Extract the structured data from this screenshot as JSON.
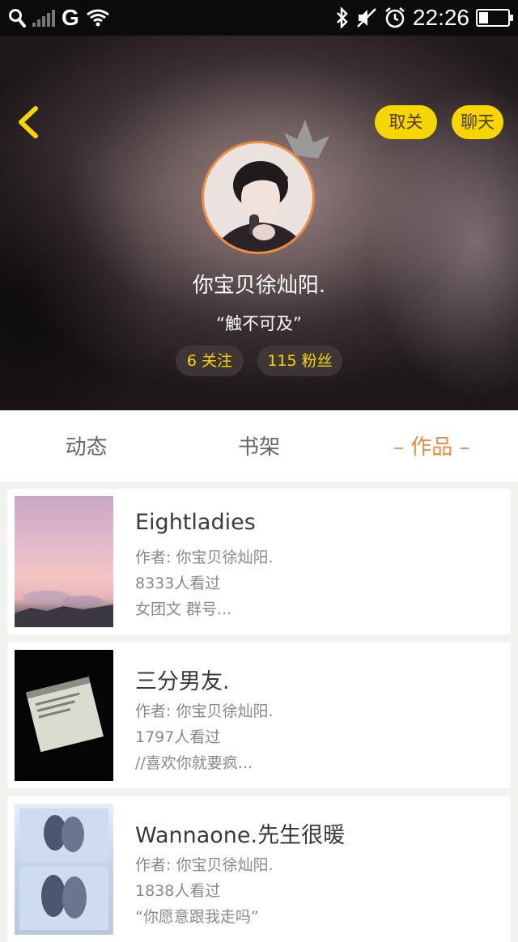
{
  "status_bar": {
    "network": "G",
    "time": "22:26"
  },
  "header": {
    "unfollow_label": "取关",
    "chat_label": "聊天",
    "nickname": "你宝贝徐灿阳.",
    "motto": "“触不可及”",
    "follow_count": "6 关注",
    "fans_count": "115 粉丝"
  },
  "tabs": [
    {
      "label": "动态"
    },
    {
      "label": "书架"
    },
    {
      "label": "– 作品 –",
      "active": true
    }
  ],
  "works": [
    {
      "title": "Eightladies",
      "author": "作者: 你宝贝徐灿阳.",
      "views": "8333人看过",
      "summary": "女团文 群号..."
    },
    {
      "title": "三分男友.",
      "author": "作者: 你宝贝徐灿阳.",
      "views": "1797人看过",
      "summary": "//喜欢你就要疯..."
    },
    {
      "title": "Wannaone.先生很暖",
      "author": "作者: 你宝贝徐灿阳.",
      "views": "1838人看过",
      "summary": "“你愿意跟我走吗”"
    }
  ],
  "colors": {
    "accent": "#f08a3c",
    "button": "#f7d600",
    "stat_text": "#f7d600"
  }
}
